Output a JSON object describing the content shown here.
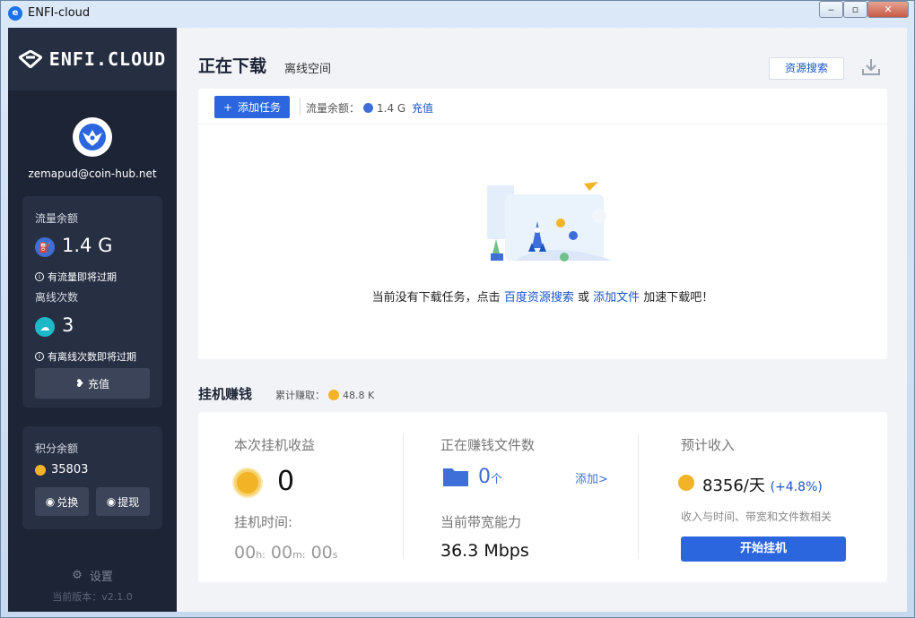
{
  "window": {
    "title": "ENFI-cloud",
    "minimize": "‒",
    "maximize": "▫",
    "close": "✕"
  },
  "sidebar": {
    "brand": "ENFI.CLOUD",
    "email": "zemapud@coin-hub.net",
    "traffic_label": "流量余额",
    "traffic_value": "1.4 G",
    "traffic_note": "有流量即将过期",
    "offline_label": "离线次数",
    "offline_value": "3",
    "offline_note": "有离线次数即将过期",
    "recharge": "充值",
    "points_label": "积分余额",
    "points_value": "35803",
    "exchange": "兑换",
    "withdraw": "提现",
    "settings": "设置",
    "version": "当前版本：v2.1.0"
  },
  "main": {
    "title": "正在下载",
    "tab_offline": "离线空间",
    "resource_search": "资源搜索",
    "add_task": "添加任务",
    "traffic_label": "流量余额：",
    "traffic_value": "1.4 G",
    "recharge": "充值",
    "empty_prefix": "当前没有下载任务，点击",
    "empty_link1": "百度资源搜索",
    "empty_or": "或",
    "empty_link2": "添加文件",
    "empty_suffix": "加速下载吧！"
  },
  "earn": {
    "title": "挂机赚钱",
    "accum_label": "累计赚取：",
    "accum_value": "48.8 K",
    "current_label": "本次挂机收益",
    "current_value": "0",
    "time_label": "挂机时间:",
    "time_h": "00",
    "time_h_unit": "h:",
    "time_m": "00",
    "time_m_unit": "m:",
    "time_s": "00",
    "time_s_unit": "s",
    "files_label": "正在赚钱文件数",
    "files_value": "0",
    "files_unit": "个",
    "add_link": "添加>",
    "bandwidth_label": "当前带宽能力",
    "bandwidth_value": "36.3 Mbps",
    "income_label": "预计收入",
    "income_value": "8356/天",
    "income_pct": "(+4.8%)",
    "income_note": "收入与时间、带宽和文件数相关",
    "start_button": "开始挂机"
  },
  "colors": {
    "sidebar": "#1d2436",
    "primary": "#2c66de",
    "link": "#1a56c4",
    "coin": "#f2b327"
  }
}
